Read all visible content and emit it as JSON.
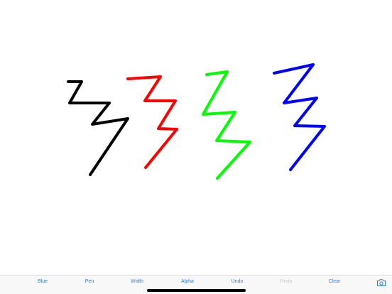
{
  "colors": {
    "accent": "#2f7fe0",
    "disabled": "#c7c7cc",
    "canvas_bg": "#ffffff",
    "toolbar_bg": "#f8f8f8"
  },
  "strokes": [
    {
      "name": "black-stroke",
      "color": "#000000"
    },
    {
      "name": "red-stroke",
      "color": "#ff0000"
    },
    {
      "name": "green-stroke",
      "color": "#00ff00"
    },
    {
      "name": "blue-stroke",
      "color": "#0000ff"
    }
  ],
  "toolbar": {
    "blue_label": "Blue",
    "pen_label": "Pen",
    "width_label": "Width",
    "alpha_label": "Alpha",
    "undo_label": "Undo",
    "redo_label": "Redo",
    "redo_enabled": false,
    "clear_label": "Clear",
    "camera_icon": "camera-icon"
  }
}
